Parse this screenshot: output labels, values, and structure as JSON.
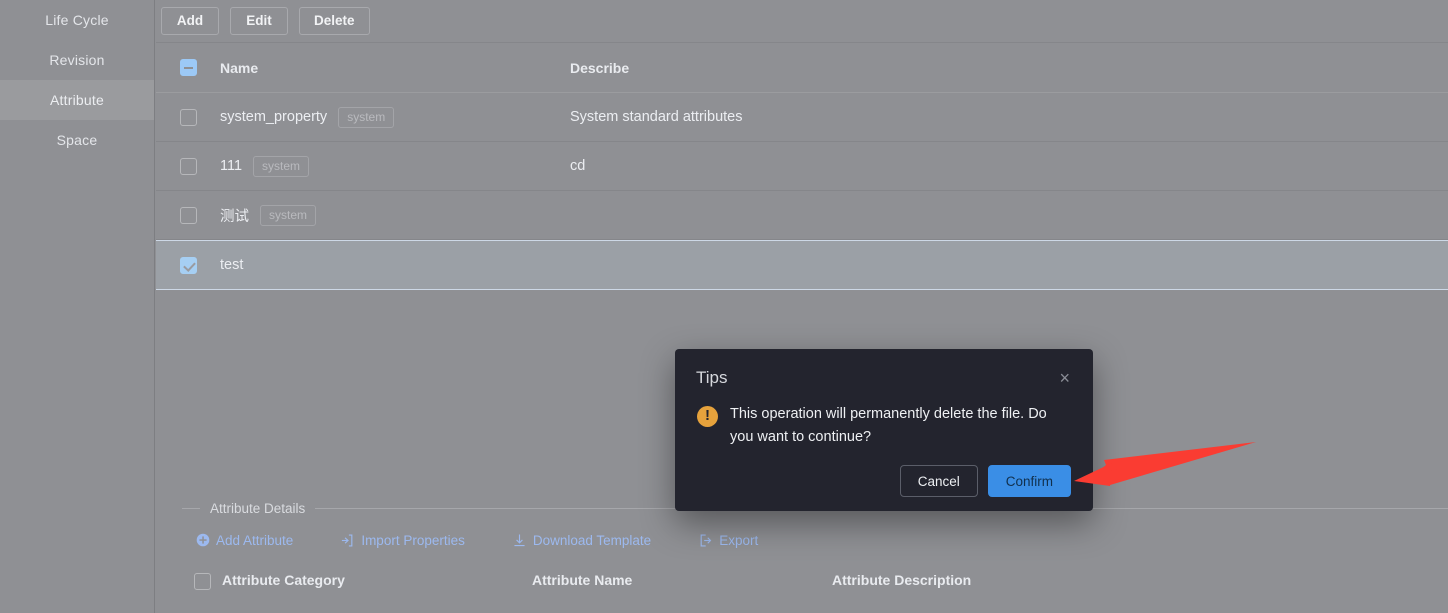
{
  "sidebar": {
    "items": [
      {
        "label": "Life Cycle",
        "active": false
      },
      {
        "label": "Revision",
        "active": false
      },
      {
        "label": "Attribute",
        "active": true
      },
      {
        "label": "Space",
        "active": false
      }
    ]
  },
  "toolbar": {
    "add_label": "Add",
    "edit_label": "Edit",
    "delete_label": "Delete"
  },
  "table": {
    "headers": {
      "name": "Name",
      "describe": "Describe"
    },
    "header_checkbox_state": "indeterminate",
    "rows": [
      {
        "checked": false,
        "name": "system_property",
        "tag": "system",
        "describe": "System standard attributes"
      },
      {
        "checked": false,
        "name": "111",
        "tag": "system",
        "describe": "cd"
      },
      {
        "checked": false,
        "name": "测试",
        "tag": "system",
        "describe": ""
      },
      {
        "checked": true,
        "name": "test",
        "tag": "",
        "describe": ""
      }
    ]
  },
  "details": {
    "legend": "Attribute Details",
    "links": [
      {
        "label": "Add Attribute",
        "icon": "plus-circle-icon"
      },
      {
        "label": "Import Properties",
        "icon": "import-icon"
      },
      {
        "label": "Download Template",
        "icon": "download-icon"
      },
      {
        "label": "Export",
        "icon": "export-icon"
      }
    ],
    "headers": {
      "category": "Attribute Category",
      "name": "Attribute Name",
      "description": "Attribute Description"
    }
  },
  "dialog": {
    "title": "Tips",
    "close_icon": "×",
    "message": "This operation will permanently delete the file. Do you want to continue?",
    "cancel_label": "Cancel",
    "confirm_label": "Confirm",
    "warning_icon": "warning-icon"
  },
  "colors": {
    "page_background": "#8f9094",
    "sidebar_active": "#9a9b9e",
    "row_selected": "#9ba0a6",
    "dialog_background": "#23242e",
    "primary": "#3a8ee6",
    "warning": "#e6a23c",
    "link": "#9cb9ef",
    "annotation_arrow": "#fa3c32"
  }
}
